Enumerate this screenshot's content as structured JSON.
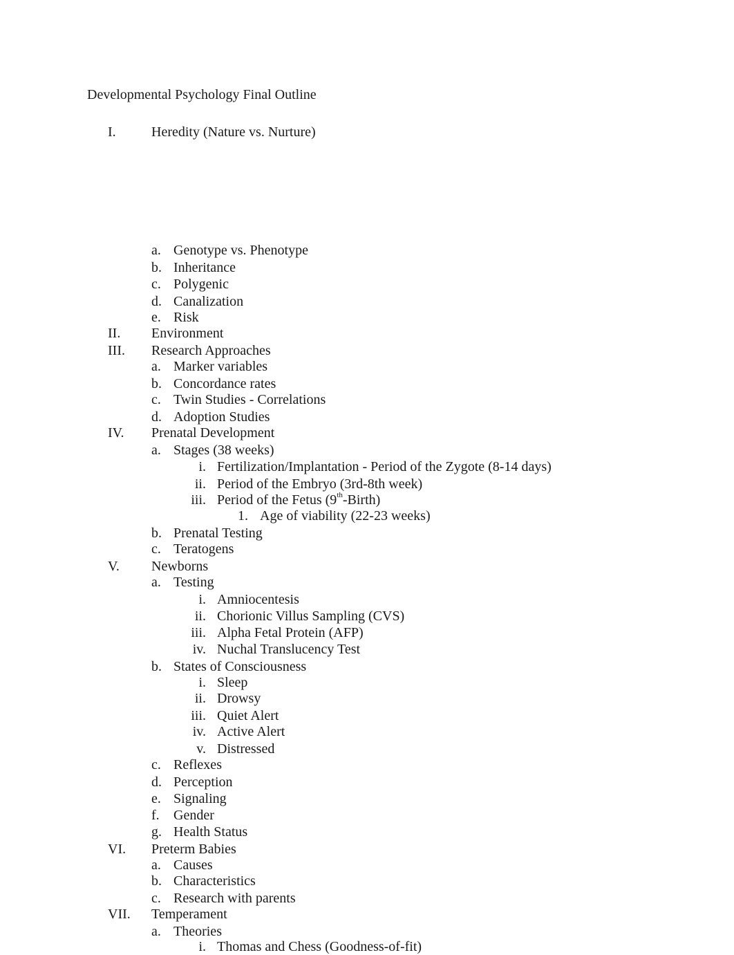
{
  "document": {
    "title": "Developmental Psychology Final Outline",
    "outline": [
      {
        "marker": "I.",
        "text": "Heredity (Nature vs. Nurture)"
      },
      {
        "marker": "a.",
        "text": "Genotype vs. Phenotype"
      },
      {
        "marker": "b.",
        "text": "Inheritance"
      },
      {
        "marker": "c.",
        "text": "Polygenic"
      },
      {
        "marker": "d.",
        "text": "Canalization"
      },
      {
        "marker": "e.",
        "text": "Risk"
      },
      {
        "marker": "II.",
        "text": "Environment"
      },
      {
        "marker": "III.",
        "text": "Research Approaches"
      },
      {
        "marker": "a.",
        "text": "Marker variables"
      },
      {
        "marker": "b.",
        "text": "Concordance rates"
      },
      {
        "marker": "c.",
        "text": "Twin Studies - Correlations"
      },
      {
        "marker": "d.",
        "text": "Adoption Studies"
      },
      {
        "marker": "IV.",
        "text": "Prenatal Development"
      },
      {
        "marker": "a.",
        "text": "Stages (38 weeks)"
      },
      {
        "marker": "i.",
        "text": "Fertilization/Implantation - Period of the Zygote  (8-14 days)"
      },
      {
        "marker": "ii.",
        "text": "Period of the Embryo (3rd-8th week)"
      },
      {
        "marker": "iii.",
        "text_before": "Period of the Fetus (9",
        "text_sup": "th",
        "text_after": "-Birth)"
      },
      {
        "marker": "1.",
        "text": "Age of viability (22-23 weeks)"
      },
      {
        "marker": "b.",
        "text": "Prenatal Testing"
      },
      {
        "marker": "c.",
        "text": "Teratogens"
      },
      {
        "marker": "V.",
        "text": "Newborns"
      },
      {
        "marker": "a.",
        "text": "Testing"
      },
      {
        "marker": "i.",
        "text": "Amniocentesis"
      },
      {
        "marker": "ii.",
        "text": "Chorionic Villus Sampling (CVS)"
      },
      {
        "marker": "iii.",
        "text": "Alpha Fetal Protein (AFP)"
      },
      {
        "marker": "iv.",
        "text": "Nuchal Translucency Test"
      },
      {
        "marker": "b.",
        "text": "States of Consciousness"
      },
      {
        "marker": "i.",
        "text": "Sleep"
      },
      {
        "marker": "ii.",
        "text": "Drowsy"
      },
      {
        "marker": "iii.",
        "text": "Quiet Alert"
      },
      {
        "marker": "iv.",
        "text": "Active Alert"
      },
      {
        "marker": "v.",
        "text": "Distressed"
      },
      {
        "marker": "c.",
        "text": "Reflexes"
      },
      {
        "marker": "d.",
        "text": "Perception"
      },
      {
        "marker": "e.",
        "text": "Signaling"
      },
      {
        "marker": "f.",
        "text": "Gender"
      },
      {
        "marker": "g.",
        "text": "Health Status"
      },
      {
        "marker": "VI.",
        "text": "Preterm Babies"
      },
      {
        "marker": "a.",
        "text": "Causes"
      },
      {
        "marker": "b.",
        "text": "Characteristics"
      },
      {
        "marker": "c.",
        "text": "Research with parents"
      },
      {
        "marker": "VII.",
        "text": "Temperament"
      },
      {
        "marker": "a.",
        "text": "Theories"
      },
      {
        "marker": "i.",
        "text": "Thomas and Chess (Goodness-of-fit)"
      }
    ]
  }
}
